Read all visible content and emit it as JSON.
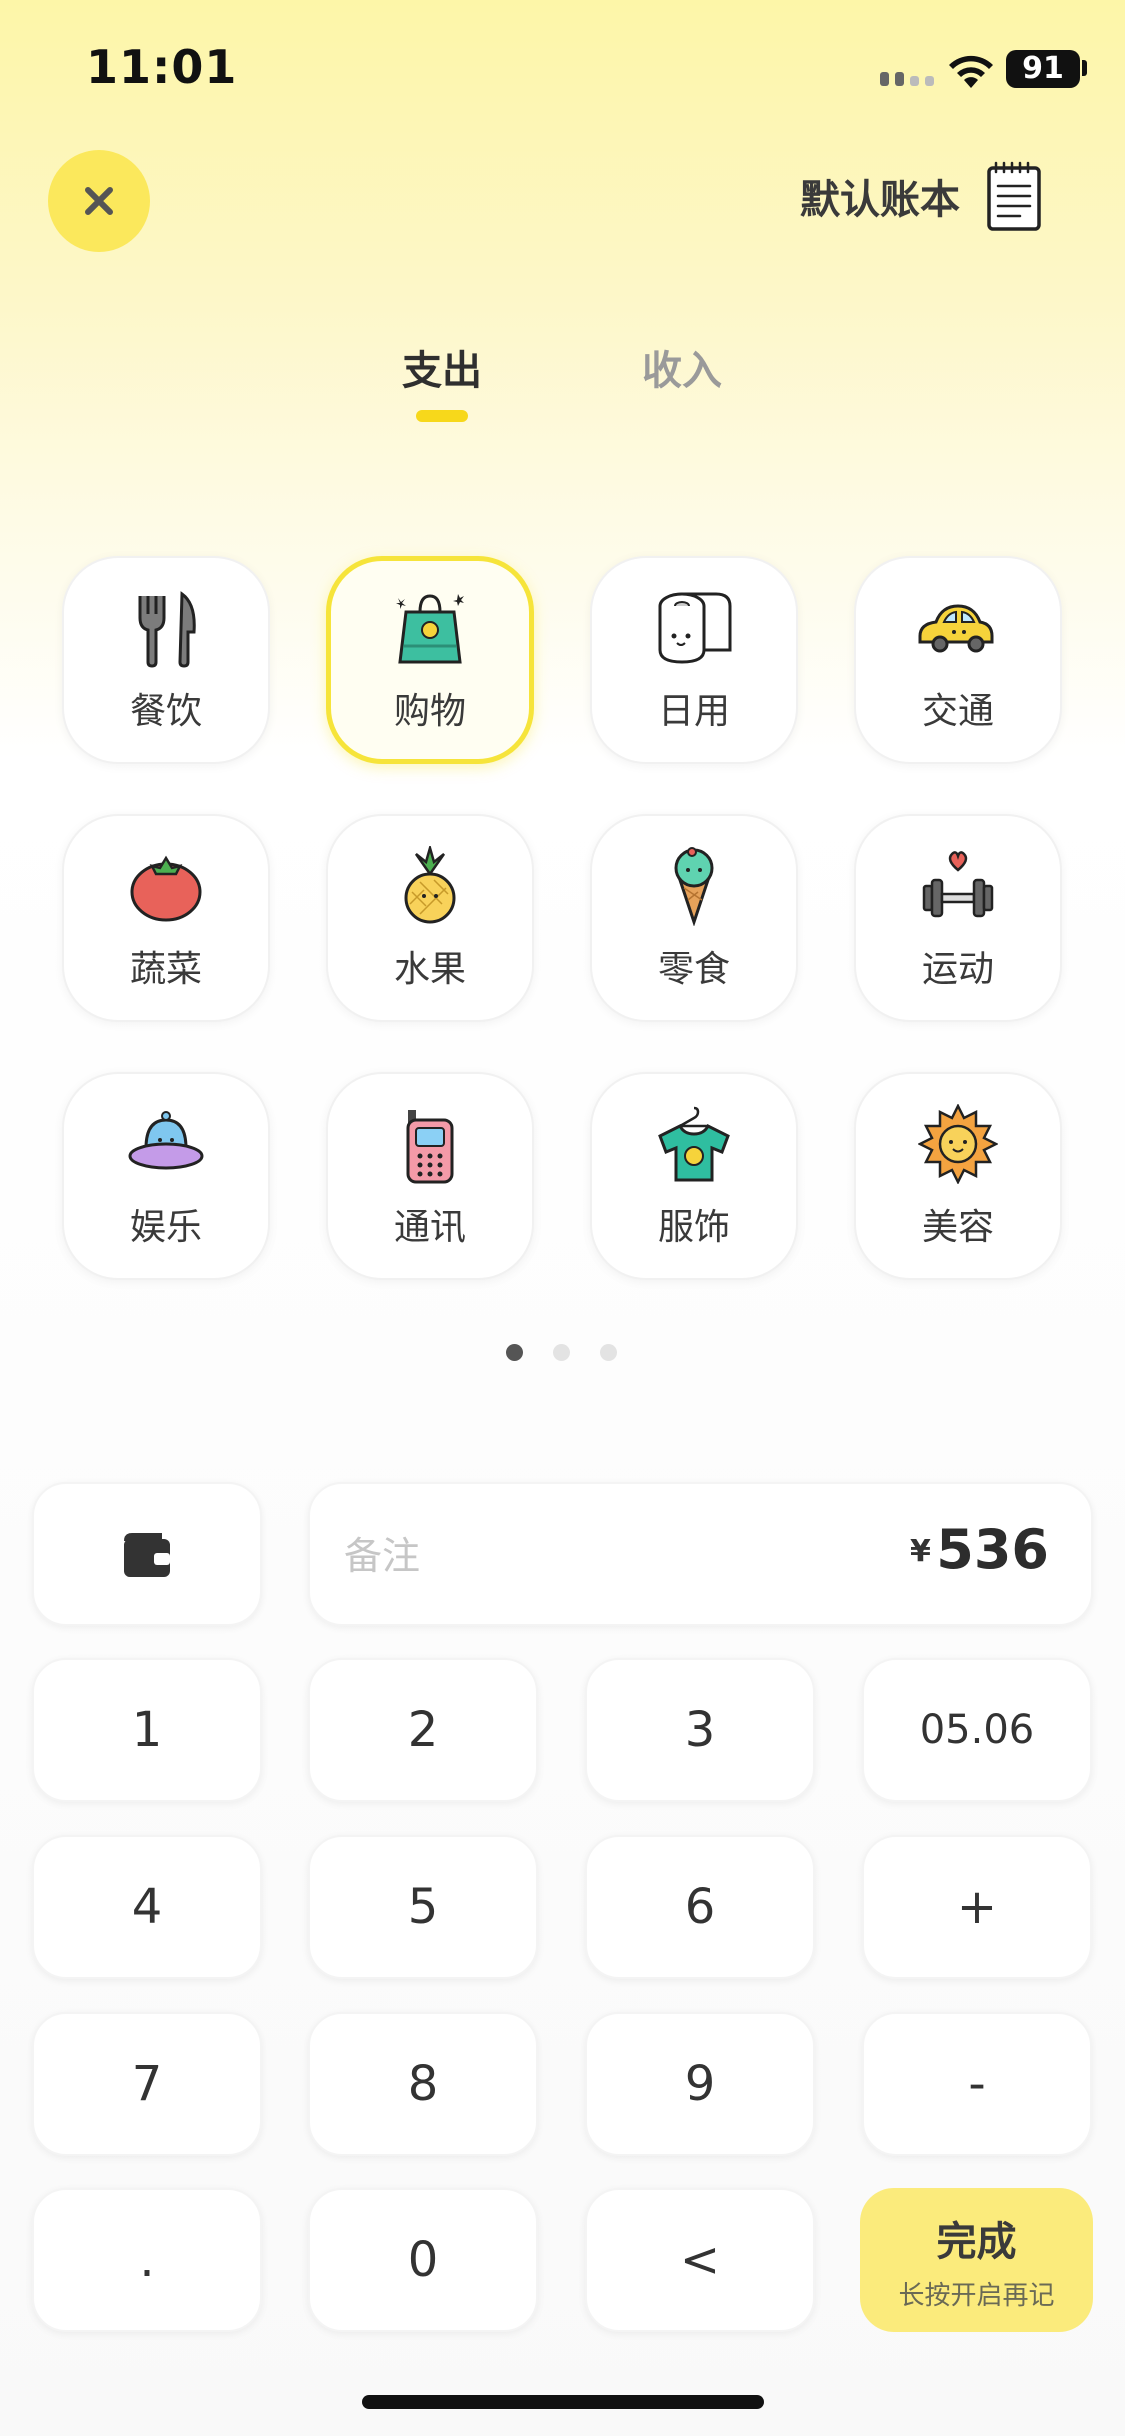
{
  "status_bar": {
    "time": "11:01",
    "battery": "91"
  },
  "header": {
    "ledger_name": "默认账本",
    "close_icon": "close-icon",
    "ledger_icon": "notebook-icon"
  },
  "tabs": [
    {
      "label": "支出",
      "active": true
    },
    {
      "label": "收入",
      "active": false
    }
  ],
  "categories": [
    {
      "label": "餐饮",
      "icon": "fork-knife-icon",
      "selected": false
    },
    {
      "label": "购物",
      "icon": "shopping-bag-icon",
      "selected": true
    },
    {
      "label": "日用",
      "icon": "toilet-paper-icon",
      "selected": false
    },
    {
      "label": "交通",
      "icon": "car-icon",
      "selected": false
    },
    {
      "label": "蔬菜",
      "icon": "tomato-icon",
      "selected": false
    },
    {
      "label": "水果",
      "icon": "pineapple-icon",
      "selected": false
    },
    {
      "label": "零食",
      "icon": "ice-cream-icon",
      "selected": false
    },
    {
      "label": "运动",
      "icon": "dumbbell-icon",
      "selected": false
    },
    {
      "label": "娱乐",
      "icon": "ufo-icon",
      "selected": false
    },
    {
      "label": "通讯",
      "icon": "phone-icon",
      "selected": false
    },
    {
      "label": "服饰",
      "icon": "t-shirt-icon",
      "selected": false
    },
    {
      "label": "美容",
      "icon": "sun-icon",
      "selected": false
    }
  ],
  "pagination": {
    "pages": 3,
    "current": 1
  },
  "entry": {
    "note_placeholder": "备注",
    "note_value": "",
    "currency": "¥",
    "amount": "536",
    "account_icon": "wallet-icon"
  },
  "keypad": {
    "keys": [
      "1",
      "2",
      "3",
      "05.06",
      "4",
      "5",
      "6",
      "+",
      "7",
      "8",
      "9",
      "-",
      ".",
      "0",
      "<"
    ],
    "done_label": "完成",
    "done_sub": "长按开启再记"
  },
  "colors": {
    "accent": "#f7d81b",
    "button_yellow": "#fbe85c",
    "done_yellow": "#fbeb7c"
  }
}
